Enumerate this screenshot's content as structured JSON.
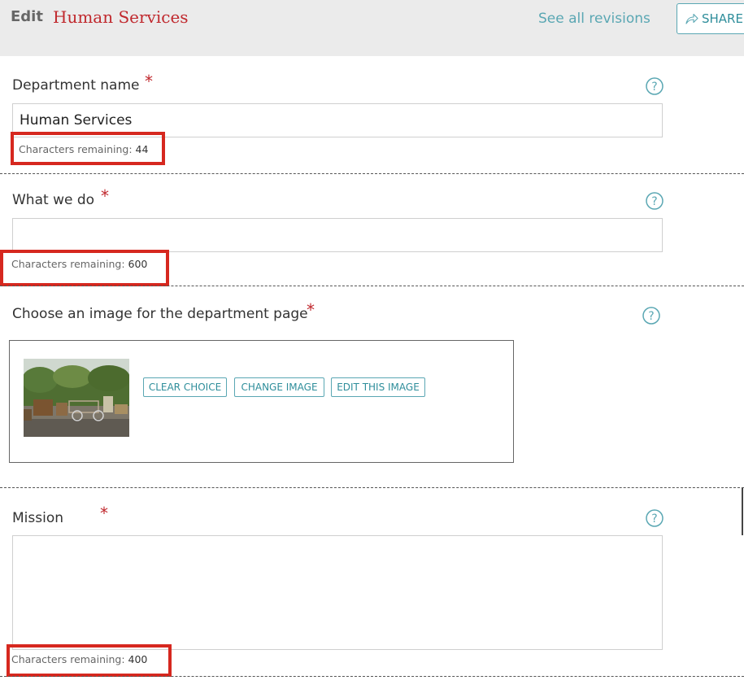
{
  "header": {
    "edit_label": "Edit",
    "page_name": "Human Services",
    "revisions_link": "See all revisions",
    "share_label": "SHARE"
  },
  "fields": {
    "department_name": {
      "label": "Department name",
      "required_mark": "*",
      "value": "Human Services",
      "counter_label": "Characters remaining:",
      "counter_value": "44"
    },
    "what_we_do": {
      "label": "What we do",
      "required_mark": "*",
      "value": "",
      "counter_label": "Characters remaining:",
      "counter_value": "600"
    },
    "image": {
      "label": "Choose an image for the department page",
      "required_mark": "*",
      "buttons": {
        "clear": "CLEAR CHOICE",
        "change": "CHANGE IMAGE",
        "edit": "EDIT THIS IMAGE"
      }
    },
    "mission": {
      "label": "Mission",
      "required_mark": "*",
      "value": "",
      "counter_label": "Characters remaining:",
      "counter_value": "400"
    }
  },
  "colors": {
    "accent": "#5aa7b3",
    "brand_red": "#c0282d",
    "highlight": "#d6281f",
    "header_bg": "#ebebeb"
  },
  "icons": {
    "help": "question-circle-icon",
    "share": "share-arrow-icon"
  }
}
